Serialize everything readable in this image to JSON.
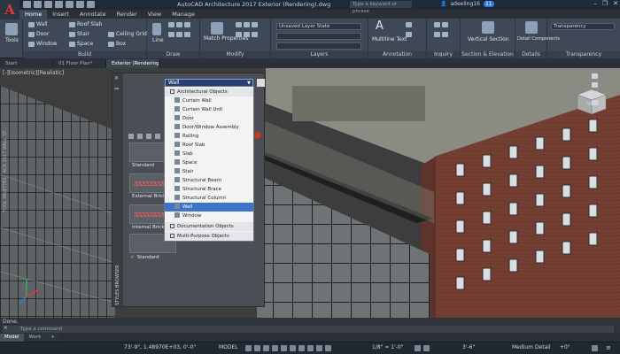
{
  "app": {
    "logo_letter": "A",
    "title": "AutoCAD Architecture 2017   Exterior (Rendering).dwg",
    "search_placeholder": "Type a keyword or phrase",
    "user": "adeeling16",
    "badge": "11",
    "window_controls": [
      "–",
      "❐",
      "✕"
    ]
  },
  "ribbon": {
    "tabs": [
      "Home",
      "Insert",
      "Annotate",
      "Render",
      "View",
      "Manage"
    ],
    "active_tab": "Home",
    "panels": {
      "tools_label": "Tools",
      "build": {
        "title": "Build",
        "items": [
          "Wall",
          "Door",
          "Window",
          "Roof Slab",
          "Stair",
          "Space",
          "Ceiling Grid",
          "Box"
        ]
      },
      "draw": {
        "title": "Draw",
        "line_label": "Line"
      },
      "modify": {
        "title": "Modify",
        "match_label": "Match Properties"
      },
      "layers": {
        "title": "Layers",
        "layer_state": "Unsaved Layer State"
      },
      "annotation": {
        "title": "Annotation",
        "mtext_label": "Multiline Text"
      },
      "inquiry": {
        "title": "Inquiry"
      },
      "section": {
        "title": "Section & Elevation",
        "vertical_label": "Vertical Section"
      },
      "details": {
        "title": "Details",
        "components_label": "Detail Components"
      },
      "transparency": {
        "title": "Transparency",
        "field_label": "Transparency"
      }
    }
  },
  "doc_tabs": [
    "Start",
    "01 Floor Plan*",
    "Exterior (Rendering)*"
  ],
  "viewport": {
    "label": "[-][Isometric][Realistic]",
    "viewcube_label": "View"
  },
  "palette": {
    "filter_value": "Wall",
    "side_label": "TOOL PALETTES - ACA 2017 WALL ST...",
    "styles_browser_label": "STYLES BROWSER",
    "styles": [
      "Standard",
      "External Brick",
      "Internal Brick"
    ],
    "checked_style": "Standard",
    "dropdown": {
      "category_top": "Architectural Objects",
      "items": [
        "Curtain Wall",
        "Curtain Wall Unit",
        "Door",
        "Door/Window Assembly",
        "Railing",
        "Roof Slab",
        "Slab",
        "Space",
        "Stair",
        "Structural Beam",
        "Structural Brace",
        "Structural Column",
        "Wall",
        "Window"
      ],
      "selected": "Wall",
      "category_docs": "Documentation Objects",
      "category_multi": "Multi-Purpose Objects"
    }
  },
  "command": {
    "history": "Done.",
    "placeholder": "Type a command"
  },
  "layout_tabs": [
    "Model",
    "Work",
    "+"
  ],
  "status": {
    "coords": "73'-9\", 1.48970E+03, 0'-0\"",
    "mode": "MODEL",
    "scale": "1/8\" = 1'-0\"",
    "elevation": "3'-6\"",
    "detail": "Medium Detail",
    "right_value": "+0\""
  }
}
